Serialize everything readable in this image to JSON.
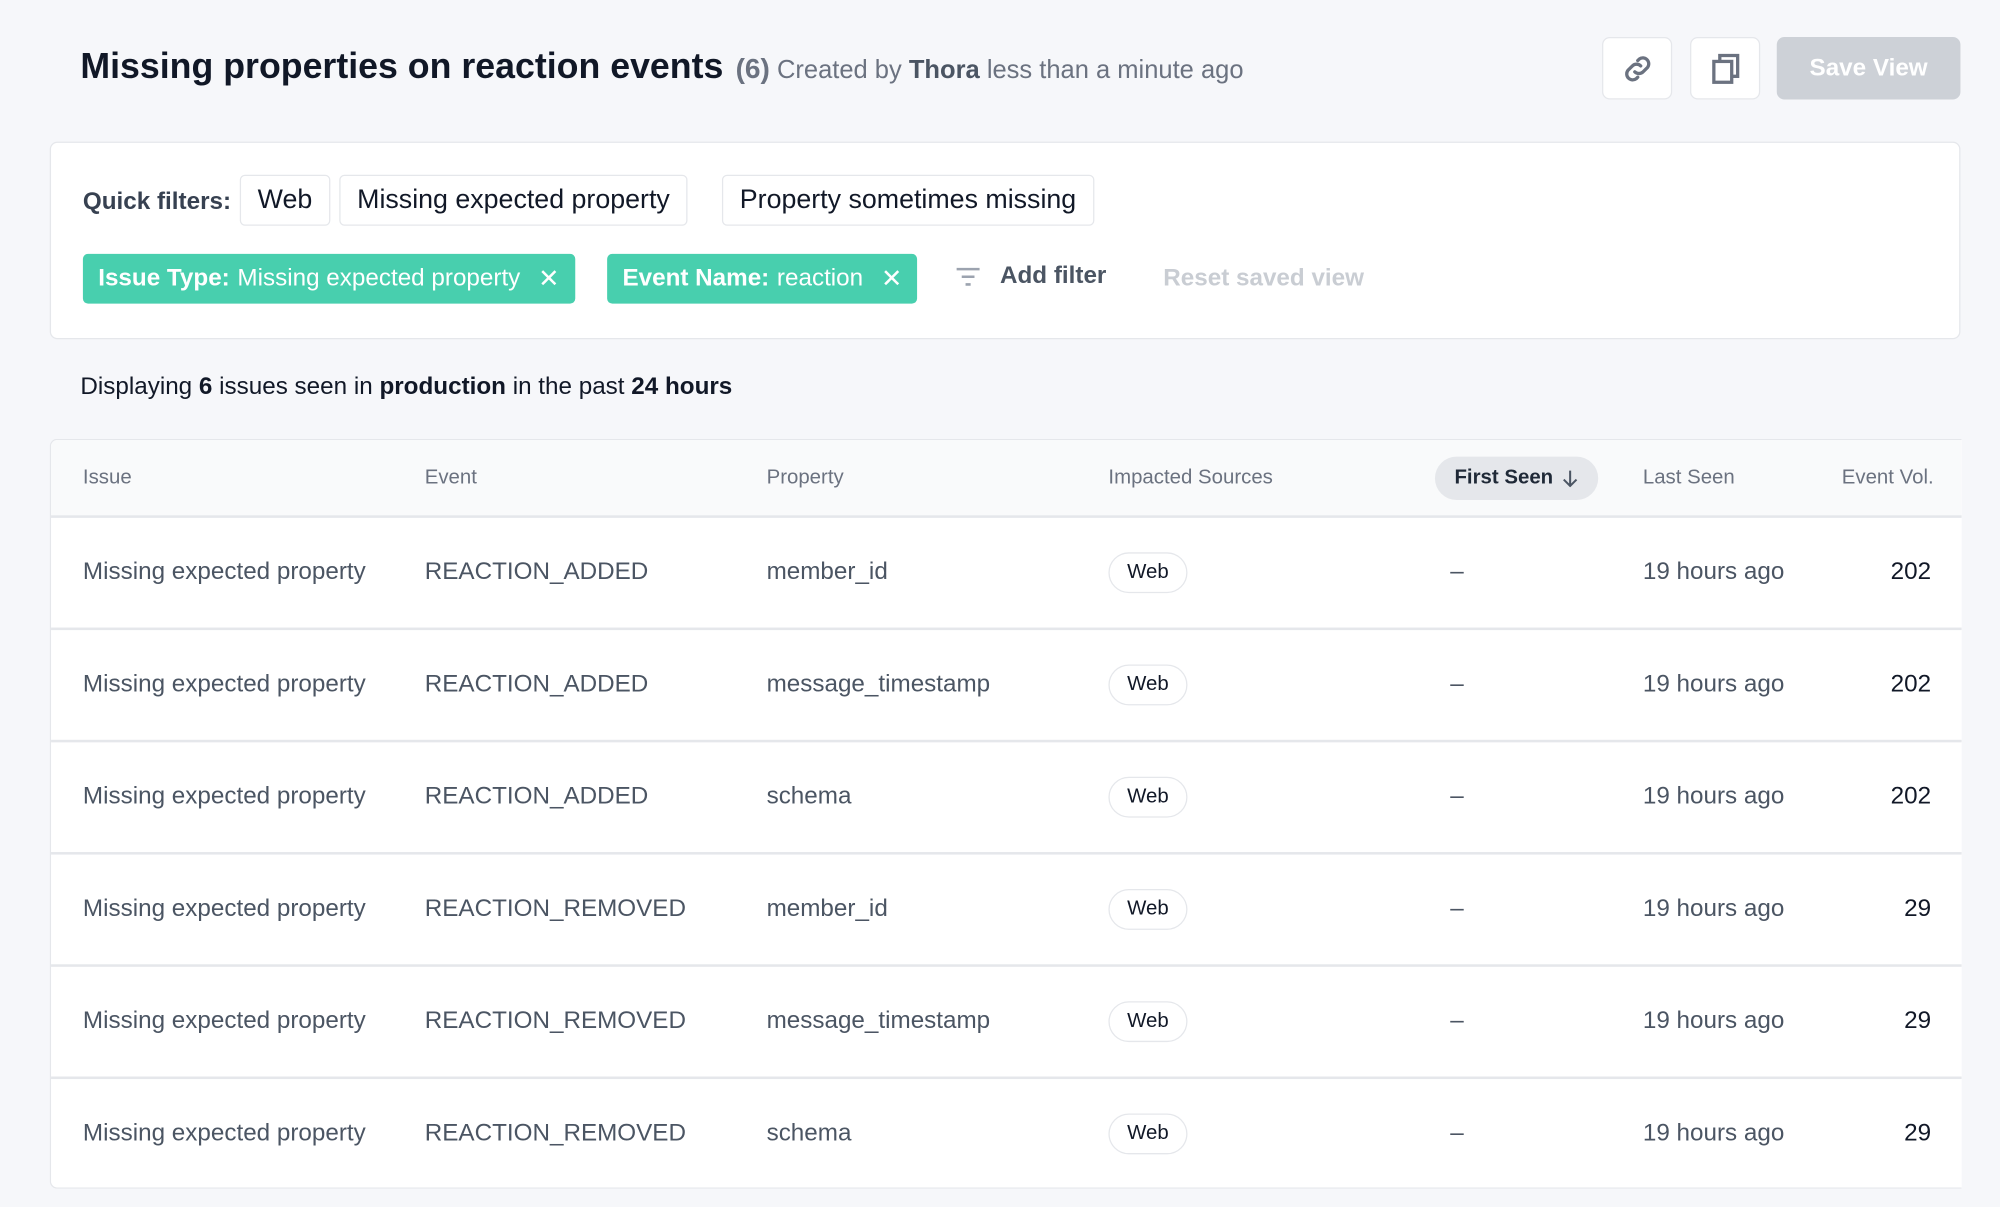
{
  "header": {
    "title": "Missing properties on reaction events",
    "count": "(6)",
    "created_prefix": "Created by",
    "author": "Thora",
    "created_suffix": "less than a minute ago",
    "link_icon": "link-icon",
    "copy_icon": "copy-icon",
    "save_label": "Save View"
  },
  "filters": {
    "quick_label": "Quick filters:",
    "quick": [
      "Web",
      "Missing expected property",
      "Property sometimes missing"
    ],
    "active": [
      {
        "key": "Issue Type:",
        "value": "Missing expected property"
      },
      {
        "key": "Event Name:",
        "value": "reaction"
      }
    ],
    "remove_glyph": "✕",
    "add_filter": "Add filter",
    "reset": "Reset saved view",
    "accent": "#48cfae"
  },
  "summary": {
    "p1": "Displaying ",
    "count": "6",
    "p2": " issues seen in ",
    "env": "production",
    "p3": " in the past ",
    "window": "24 hours"
  },
  "table": {
    "columns": [
      "Issue",
      "Event",
      "Property",
      "Impacted Sources",
      "First Seen",
      "Last Seen",
      "Event Vol."
    ],
    "sort_column": "First Seen",
    "sort_direction": "descending",
    "rows": [
      {
        "issue": "Missing expected property",
        "event": "REACTION_ADDED",
        "property": "member_id",
        "source": "Web",
        "first_seen": "–",
        "last_seen": "19 hours ago",
        "volume": "202"
      },
      {
        "issue": "Missing expected property",
        "event": "REACTION_ADDED",
        "property": "message_timestamp",
        "source": "Web",
        "first_seen": "–",
        "last_seen": "19 hours ago",
        "volume": "202"
      },
      {
        "issue": "Missing expected property",
        "event": "REACTION_ADDED",
        "property": "schema",
        "source": "Web",
        "first_seen": "–",
        "last_seen": "19 hours ago",
        "volume": "202"
      },
      {
        "issue": "Missing expected property",
        "event": "REACTION_REMOVED",
        "property": "member_id",
        "source": "Web",
        "first_seen": "–",
        "last_seen": "19 hours ago",
        "volume": "29"
      },
      {
        "issue": "Missing expected property",
        "event": "REACTION_REMOVED",
        "property": "message_timestamp",
        "source": "Web",
        "first_seen": "–",
        "last_seen": "19 hours ago",
        "volume": "29"
      },
      {
        "issue": "Missing expected property",
        "event": "REACTION_REMOVED",
        "property": "schema",
        "source": "Web",
        "first_seen": "–",
        "last_seen": "19 hours ago",
        "volume": "29"
      }
    ]
  }
}
